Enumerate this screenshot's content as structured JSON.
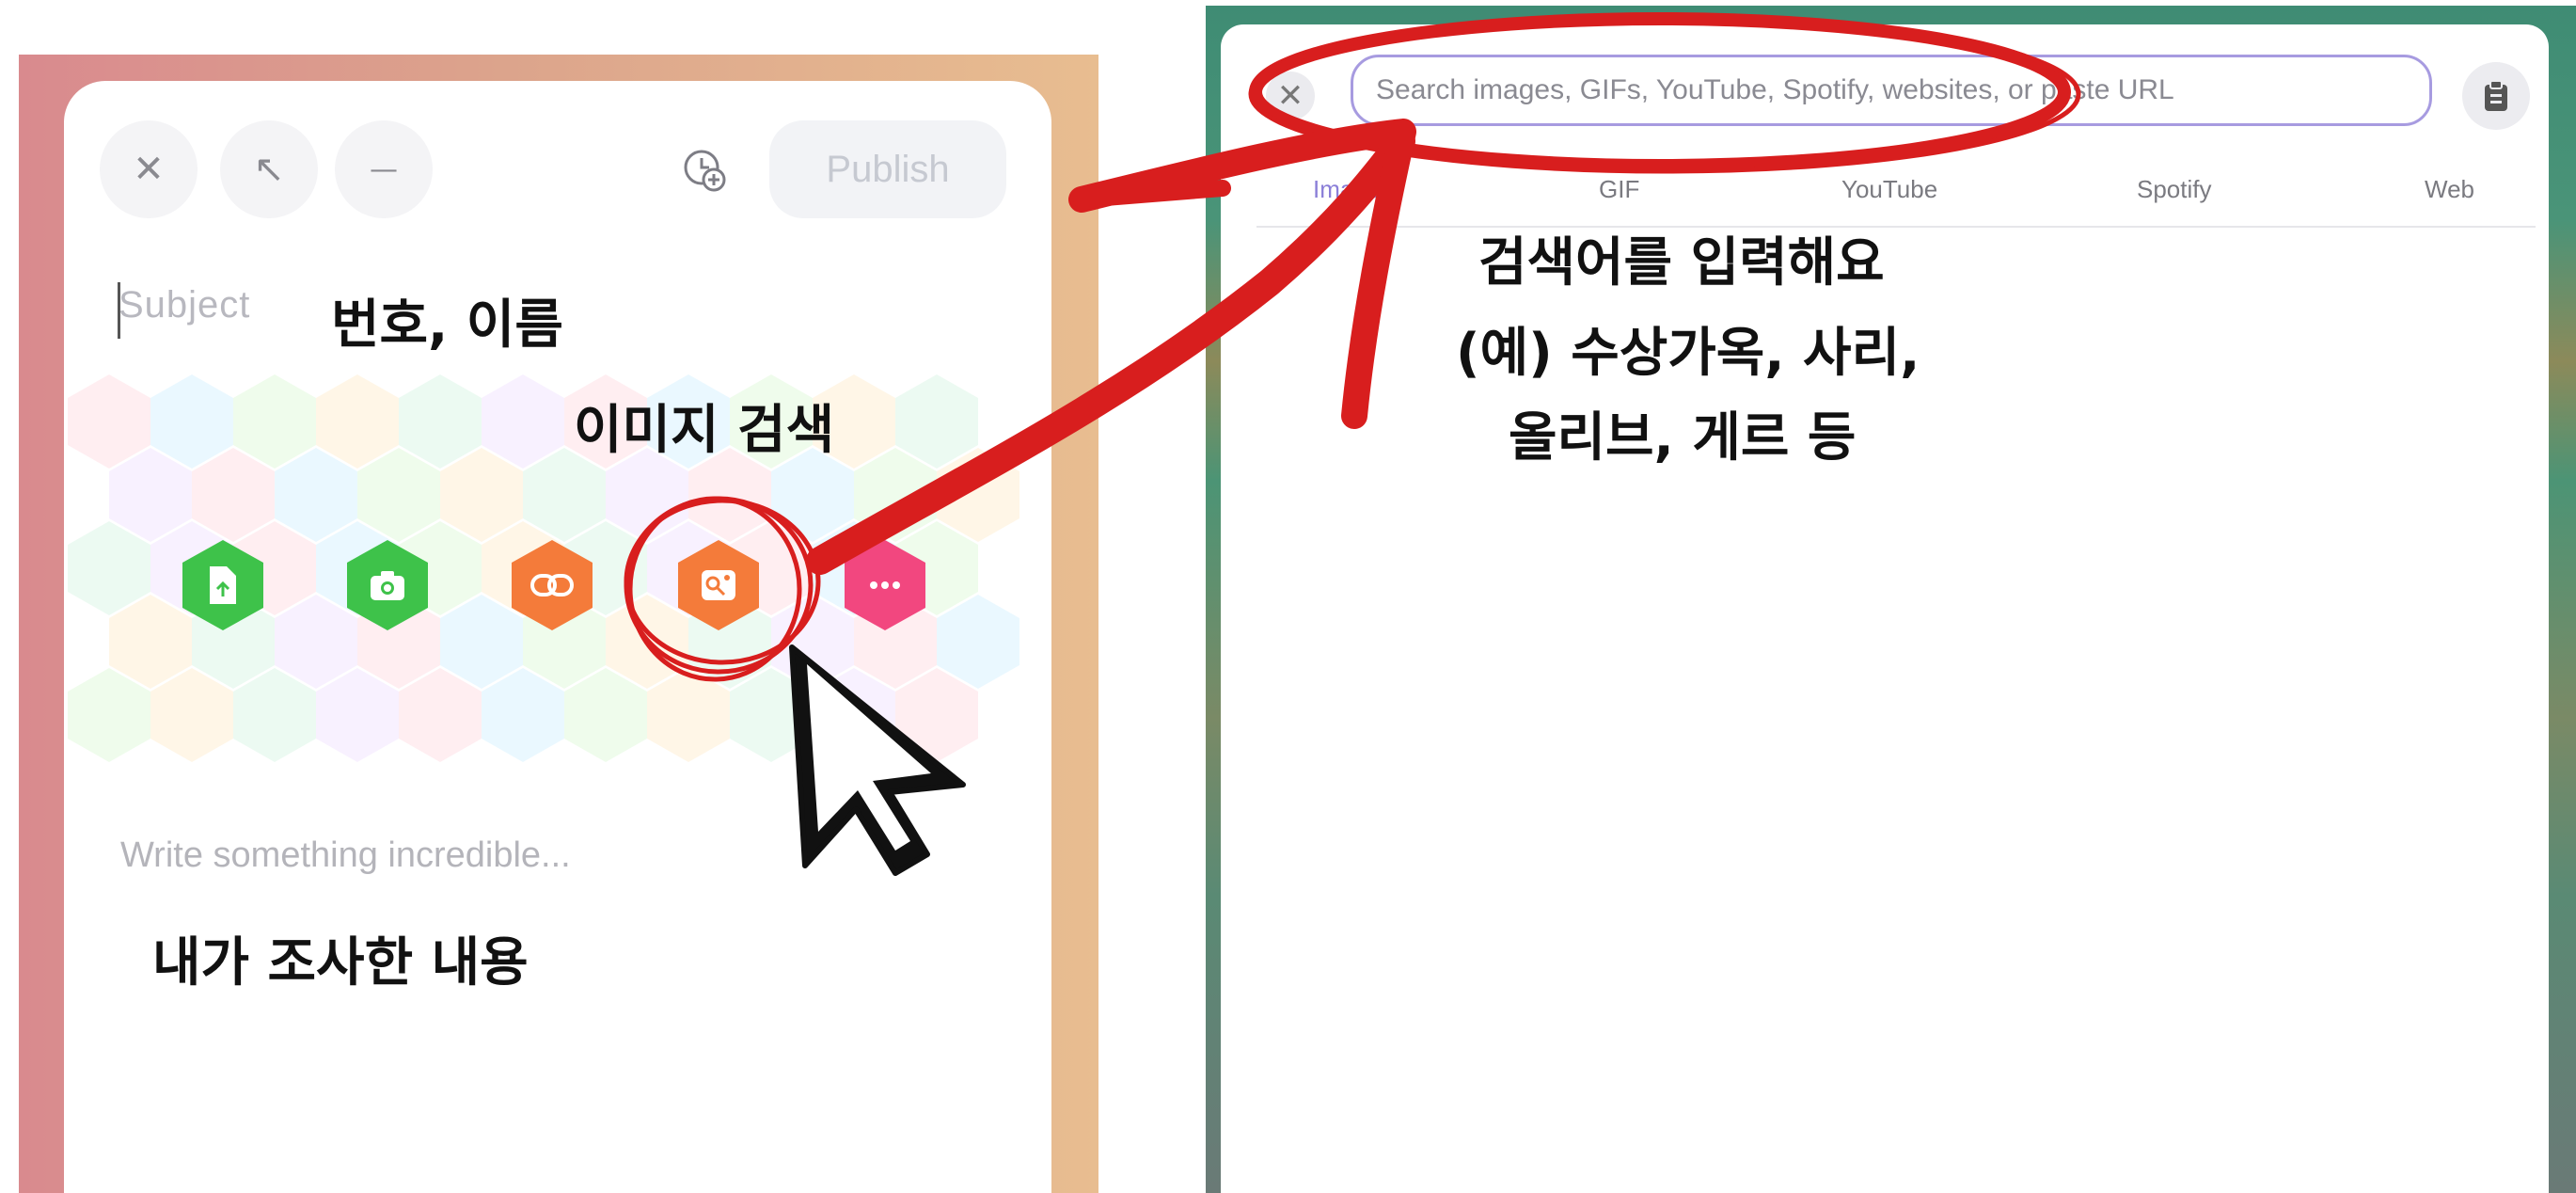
{
  "composer": {
    "toolbar": {
      "close_label": "✕",
      "expand_label": "↖",
      "minimize_label": "—",
      "publish_label": "Publish"
    },
    "subject_placeholder": "Subject",
    "body_placeholder": "Write something incredible...",
    "attachments": [
      {
        "icon": "upload-file-icon",
        "color": "#3ec24a"
      },
      {
        "icon": "camera-icon",
        "color": "#3ec24a"
      },
      {
        "icon": "link-icon",
        "color": "#f47b3a"
      },
      {
        "icon": "image-search-icon",
        "color": "#f47b3a"
      },
      {
        "icon": "more-icon",
        "color": "#f2477f"
      }
    ]
  },
  "search_panel": {
    "close_label": "✕",
    "placeholder": "Search images, GIFs, YouTube, Spotify, websites, or paste URL",
    "tabs": [
      {
        "label": "Images",
        "active": true
      },
      {
        "label": "GIF",
        "active": false
      },
      {
        "label": "YouTube",
        "active": false
      },
      {
        "label": "Spotify",
        "active": false
      },
      {
        "label": "Web",
        "active": false
      }
    ]
  },
  "annotations": {
    "subject_note": "번호, 이름",
    "image_search_note": "이미지 검색",
    "body_note": "내가 조사한 내용",
    "search_note_line1": "검색어를 입력해요",
    "search_note_line2": "(예) 수상가옥, 사리,",
    "search_note_line3": "올리브, 게르 등"
  },
  "colors": {
    "accent_purple": "#a79be0",
    "annotation_red": "#d81e1e",
    "green": "#3ec24a",
    "orange": "#f47b3a",
    "pink": "#f2477f"
  }
}
